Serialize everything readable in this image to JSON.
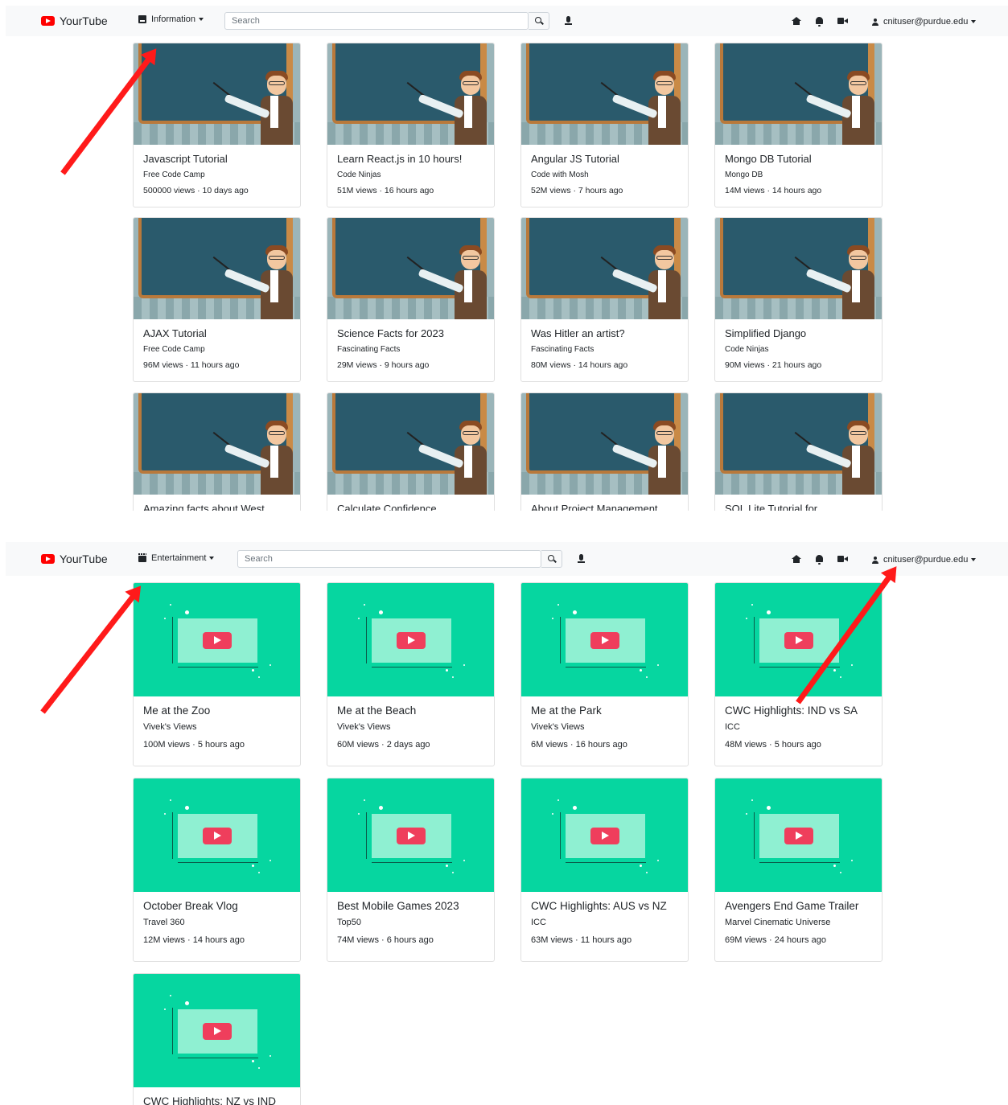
{
  "screens": [
    {
      "brand": "YourTube",
      "category": "Information",
      "category_icon": "book-icon",
      "search_placeholder": "Search",
      "user": "cnituser@purdue.edu",
      "thumbnail": "teacher-illustration",
      "videos": [
        {
          "title": "Javascript Tutorial",
          "channel": "Free Code Camp",
          "stats": "500000 views · 10 days ago"
        },
        {
          "title": "Learn React.js in 10 hours!",
          "channel": "Code Ninjas",
          "stats": "51M views · 16 hours ago"
        },
        {
          "title": "Angular JS Tutorial",
          "channel": "Code with Mosh",
          "stats": "52M views · 7 hours ago"
        },
        {
          "title": "Mongo DB Tutorial",
          "channel": "Mongo DB",
          "stats": "14M views · 14 hours ago"
        },
        {
          "title": "AJAX Tutorial",
          "channel": "Free Code Camp",
          "stats": "96M views · 11 hours ago"
        },
        {
          "title": "Science Facts for 2023",
          "channel": "Fascinating Facts",
          "stats": "29M views · 9 hours ago"
        },
        {
          "title": "Was Hitler an artist?",
          "channel": "Fascinating Facts",
          "stats": "80M views · 14 hours ago"
        },
        {
          "title": "Simplified Django",
          "channel": "Code Ninjas",
          "stats": "90M views · 21 hours ago"
        },
        {
          "title": "Amazing facts about West",
          "channel": "",
          "stats": ""
        },
        {
          "title": "Calculate Confidence",
          "channel": "",
          "stats": ""
        },
        {
          "title": "About Project Management",
          "channel": "",
          "stats": ""
        },
        {
          "title": "SQL Lite Tutorial for",
          "channel": "",
          "stats": ""
        }
      ]
    },
    {
      "brand": "YourTube",
      "category": "Entertainment",
      "category_icon": "film-icon",
      "search_placeholder": "Search",
      "user": "cnituser@purdue.edu",
      "thumbnail": "video-illustration",
      "videos": [
        {
          "title": "Me at the Zoo",
          "channel": "Vivek's Views",
          "stats": "100M views · 5 hours ago"
        },
        {
          "title": "Me at the Beach",
          "channel": "Vivek's Views",
          "stats": "60M views · 2 days ago"
        },
        {
          "title": "Me at the Park",
          "channel": "Vivek's Views",
          "stats": "6M views · 16 hours ago"
        },
        {
          "title": "CWC Highlights: IND vs SA",
          "channel": "ICC",
          "stats": "48M views · 5 hours ago"
        },
        {
          "title": "October Break Vlog",
          "channel": "Travel 360",
          "stats": "12M views · 14 hours ago"
        },
        {
          "title": "Best Mobile Games 2023",
          "channel": "Top50",
          "stats": "74M views · 6 hours ago"
        },
        {
          "title": "CWC Highlights: AUS vs NZ",
          "channel": "ICC",
          "stats": "63M views · 11 hours ago"
        },
        {
          "title": "Avengers End Game Trailer",
          "channel": "Marvel Cinematic Universe",
          "stats": "69M views · 24 hours ago"
        },
        {
          "title": "CWC Highlights: NZ vs IND",
          "channel": "",
          "stats": ""
        }
      ]
    }
  ],
  "colors": {
    "brand_red": "#ff0000",
    "annotation_arrow": "#ff1a1a",
    "video_thumb_bg": "#06d6a0",
    "play_button": "#ef3e5c",
    "chalkboard": "#2a5a6c"
  }
}
